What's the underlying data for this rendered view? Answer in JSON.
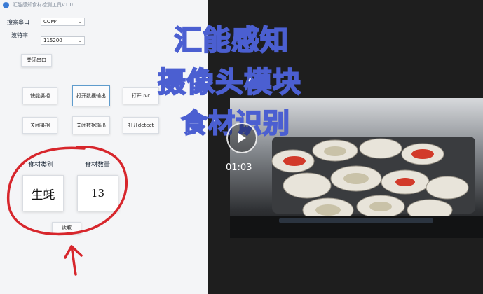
{
  "window": {
    "title": "汇能感知食材检测工具V1.0"
  },
  "serial": {
    "port_label": "搜索串口",
    "port_value": "COM4",
    "baud_label": "波特率",
    "baud_value": "115200",
    "close_button": "关闭串口"
  },
  "buttons": {
    "open_camera": "使能摄相",
    "open_output": "打开数据输出",
    "open_uvc": "打开uvc",
    "close_camera": "关闭摄相",
    "close_output": "关闭数据输出",
    "open_detect": "打开detect",
    "read": "读取"
  },
  "result": {
    "type_label": "食材类别",
    "count_label": "食材数量",
    "type_value": "生蚝",
    "count_value": "13"
  },
  "overlay": {
    "line1": "汇能感知",
    "line2": "摄像头模块",
    "line3": "食材识别"
  },
  "video": {
    "timestamp": "01:03",
    "play_icon": "play-icon"
  },
  "colors": {
    "annotation_red": "#d7262c",
    "overlay_stroke": "#4b5fd1"
  }
}
